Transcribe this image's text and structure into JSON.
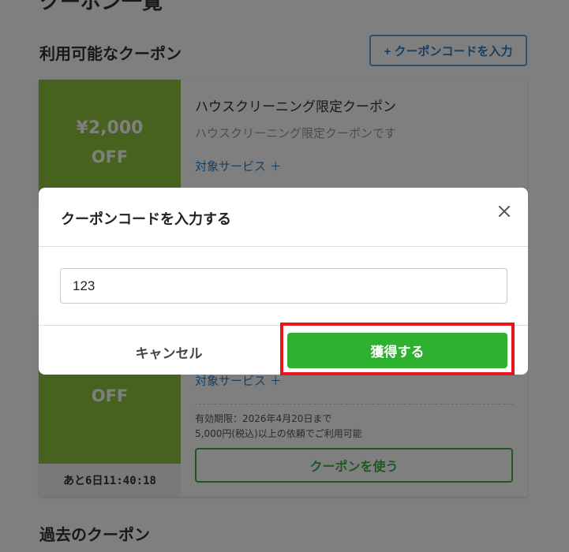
{
  "page": {
    "title": "クーポン一覧",
    "available_title": "利用可能なクーポン",
    "past_title": "過去のクーポン",
    "code_button_label": "+ クーポンコードを入力"
  },
  "coupons": [
    {
      "amount": "¥2,000",
      "off": "OFF",
      "name": "ハウスクリーニング限定クーポン",
      "description": "ハウスクリーニング限定クーポンです",
      "target_link": "対象サービス ＋"
    },
    {
      "off": "OFF",
      "target_link": "対象サービス ＋",
      "expiry": "有効期限：2026年4月20日まで",
      "condition": "5,000円(税込)以上の依頼でご利用可能",
      "use_button": "クーポンを使う",
      "countdown": "あと6日11:40:18"
    }
  ],
  "modal": {
    "title": "クーポンコードを入力する",
    "input_value": "123",
    "cancel_label": "キャンセル",
    "get_label": "獲得する"
  },
  "colors": {
    "coupon_green": "#8cc43c",
    "primary_green": "#2eb12e",
    "link_blue": "#2f7fc4",
    "highlight_red": "#e8141b"
  }
}
